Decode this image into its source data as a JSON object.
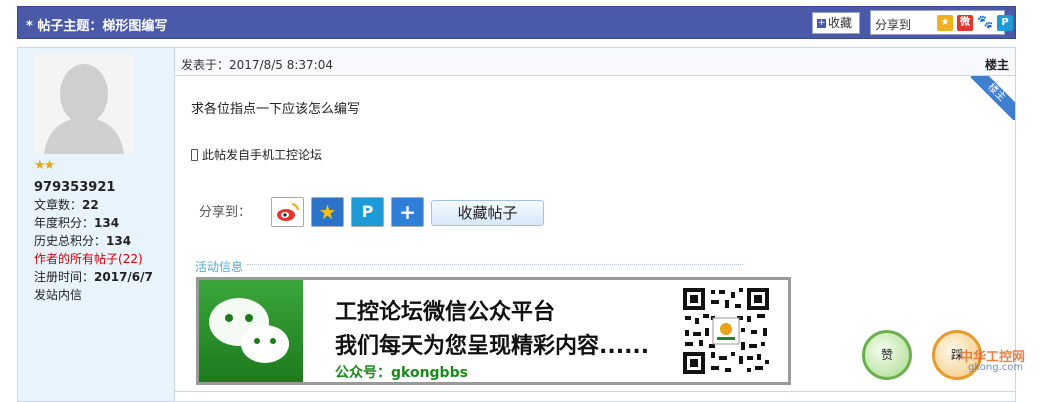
{
  "header": {
    "title": "* 帖子主题：梯形图编写",
    "favorite_label": "收藏",
    "share_label": "分享到",
    "share_icons": [
      "qzone-icon",
      "weibo-icon",
      "baidu-icon",
      "tencent-weibo-icon"
    ]
  },
  "author": {
    "name": "979353921",
    "stars": "★★",
    "posts_label": "文章数：",
    "posts_value": "22",
    "year_points_label": "年度积分：",
    "year_points_value": "134",
    "total_points_label": "历史总积分：",
    "total_points_value": "134",
    "all_posts_label": "作者的所有帖子",
    "all_posts_count": "(22)",
    "reg_label": "注册时间：",
    "reg_value": "2017/6/7",
    "send_msg": "发站内信"
  },
  "post": {
    "posted_at": "发表于：2017/8/5 8:37:04",
    "floor": "楼主",
    "ribbon": "楼主",
    "message": "求各位指点一下应该怎么编写",
    "mobile_note": "此帖发自手机工控论坛",
    "share_label": "分享到：",
    "collect_label": "收藏帖子",
    "activity_label": "活动信息"
  },
  "banner": {
    "line1": "工控论坛微信公众平台",
    "line2": "我们每天为您呈现精彩内容......",
    "line3": "公众号：gkongbbs"
  },
  "actions": {
    "like": "赞",
    "tread": "踩"
  },
  "watermark": {
    "brand": "中华工控网",
    "domain": "gkong.com"
  },
  "colors": {
    "header_bg": "#4a5aa8",
    "sidebar_bg": "#e8f3fb",
    "accent_blue": "#3f7fd0",
    "red_link": "#cc0000",
    "wechat_green": "#1a8a1a"
  }
}
